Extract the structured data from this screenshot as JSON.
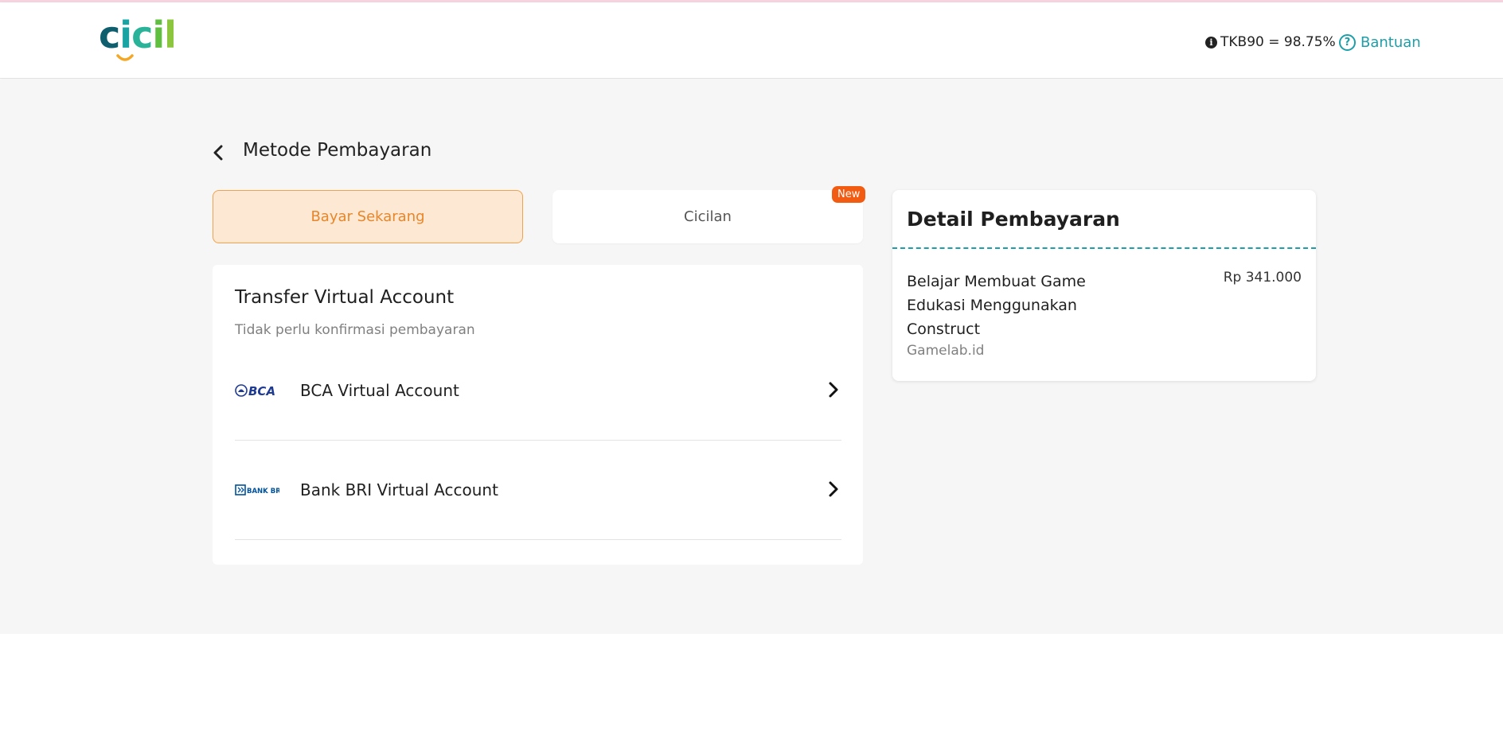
{
  "header": {
    "logo_text": "cicil",
    "tkb": "TKB90 = 98.75%",
    "help_label": "Bantuan"
  },
  "page": {
    "title": "Metode Pembayaran"
  },
  "tabs": {
    "pay_now": "Bayar Sekarang",
    "installment": "Cicilan",
    "installment_badge": "New"
  },
  "virtual_account": {
    "title": "Transfer Virtual Account",
    "subtitle": "Tidak perlu konfirmasi pembayaran",
    "options": [
      {
        "name": "BCA Virtual Account",
        "logo_text": "BCA"
      },
      {
        "name": "Bank BRI Virtual Account",
        "logo_text": "BANK BRI"
      }
    ]
  },
  "detail": {
    "title": "Detail Pembayaran",
    "item_name": "Belajar Membuat Game Edukasi Menggunakan Construct",
    "price": "Rp 341.000",
    "merchant": "Gamelab.id"
  },
  "colors": {
    "accent_teal": "#1e9ea8",
    "accent_orange": "#e8862a",
    "badge": "#f25c12",
    "bca_blue": "#1f3a93",
    "bri_blue": "#00529c"
  },
  "icons": {
    "back": "chevron-left-icon",
    "info": "info-icon",
    "help": "question-circle-icon",
    "row": "chevron-right-icon"
  }
}
